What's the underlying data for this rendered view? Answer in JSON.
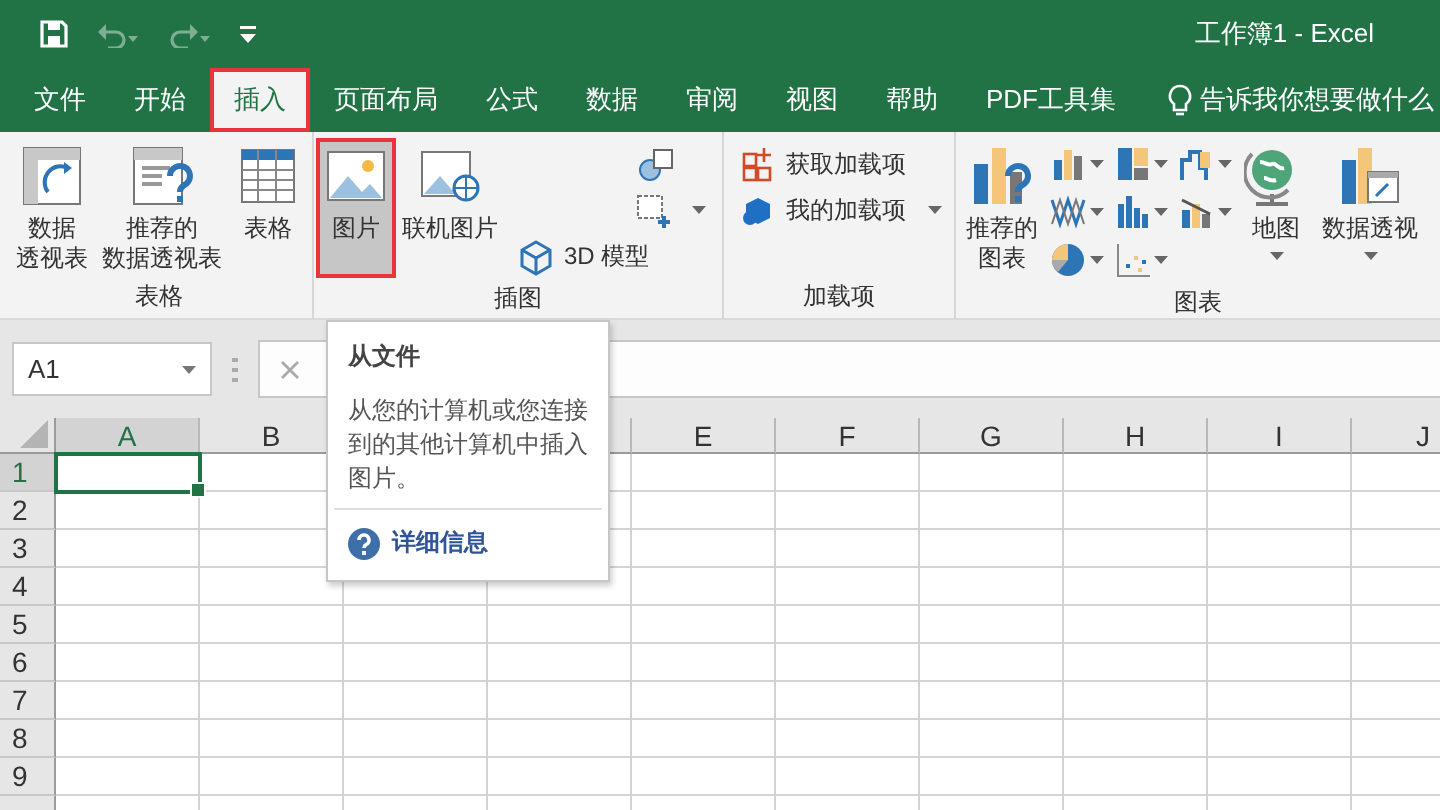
{
  "window": {
    "title": "工作簿1  -  Excel"
  },
  "quick_access": [
    {
      "kind": "save",
      "disabled": false
    },
    {
      "kind": "undo",
      "disabled": true
    },
    {
      "kind": "redo",
      "disabled": true
    },
    {
      "kind": "customize",
      "disabled": false
    }
  ],
  "tabs": [
    {
      "label": "文件",
      "selected": false,
      "highlighted": false
    },
    {
      "label": "开始",
      "selected": false,
      "highlighted": false
    },
    {
      "label": "插入",
      "selected": true,
      "highlighted": true
    },
    {
      "label": "页面布局",
      "selected": false,
      "highlighted": false
    },
    {
      "label": "公式",
      "selected": false,
      "highlighted": false
    },
    {
      "label": "数据",
      "selected": false,
      "highlighted": false
    },
    {
      "label": "审阅",
      "selected": false,
      "highlighted": false
    },
    {
      "label": "视图",
      "selected": false,
      "highlighted": false
    },
    {
      "label": "帮助",
      "selected": false,
      "highlighted": false
    },
    {
      "label": "PDF工具集",
      "selected": false,
      "highlighted": false
    }
  ],
  "tell_me": {
    "placeholder": "告诉我你想要做什么"
  },
  "ribbon": {
    "groups": [
      {
        "label": "表格",
        "items": [
          {
            "kind": "big",
            "lines": [
              "数据",
              "透视表"
            ],
            "pressed": false,
            "highlighted": false,
            "dropdown": false
          },
          {
            "kind": "big",
            "lines": [
              "推荐的",
              "数据透视表"
            ],
            "pressed": false,
            "highlighted": false,
            "dropdown": false
          },
          {
            "kind": "big",
            "lines": [
              "表格"
            ],
            "pressed": false,
            "highlighted": false,
            "dropdown": false
          }
        ]
      },
      {
        "label": "插图",
        "items": [
          {
            "kind": "big",
            "lines": [
              "图片"
            ],
            "pressed": true,
            "highlighted": true,
            "dropdown": false
          },
          {
            "kind": "big",
            "lines": [
              "联机图片"
            ],
            "pressed": false,
            "highlighted": false,
            "dropdown": false
          },
          {
            "kind": "stack",
            "items": [
              {
                "dropdown": false
              },
              {
                "dropdown": true
              },
              {
                "label": "3D 模型",
                "dropdown": false
              }
            ]
          }
        ]
      },
      {
        "label": "加载项",
        "items": [
          {
            "kind": "stack",
            "items": [
              {
                "label": "获取加载项",
                "dropdown": false
              },
              {
                "label": "我的加载项",
                "dropdown": true
              }
            ]
          }
        ]
      },
      {
        "label": "图表",
        "items": [
          {
            "kind": "big",
            "lines": [
              "推荐的",
              "图表"
            ],
            "pressed": false,
            "highlighted": false,
            "dropdown": false
          },
          {
            "kind": "gallery"
          },
          {
            "kind": "big",
            "lines": [
              "地图"
            ],
            "pressed": false,
            "highlighted": false,
            "dropdown": true
          },
          {
            "kind": "big",
            "lines": [
              "数据透视"
            ],
            "pressed": false,
            "highlighted": false,
            "dropdown": true
          }
        ]
      }
    ]
  },
  "name_box": {
    "value": "A1"
  },
  "grid": {
    "columns": [
      {
        "label": "A",
        "selected": true
      },
      {
        "label": "B",
        "selected": false
      },
      {
        "label": "E",
        "selected": false
      },
      {
        "label": "F",
        "selected": false
      },
      {
        "label": "G",
        "selected": false
      },
      {
        "label": "H",
        "selected": false
      },
      {
        "label": "I",
        "selected": false
      },
      {
        "label": "J",
        "selected": false
      }
    ],
    "rows": [
      {
        "label": "1",
        "selected": true
      },
      {
        "label": "2",
        "selected": false
      },
      {
        "label": "3",
        "selected": false
      },
      {
        "label": "4",
        "selected": false
      },
      {
        "label": "5",
        "selected": false
      },
      {
        "label": "6",
        "selected": false
      },
      {
        "label": "7",
        "selected": false
      },
      {
        "label": "8",
        "selected": false
      },
      {
        "label": "9",
        "selected": false
      }
    ]
  },
  "tooltip": {
    "title": "从文件",
    "text": "从您的计算机或您连接到的其他计算机中插入图片。",
    "link": "详细信息"
  }
}
